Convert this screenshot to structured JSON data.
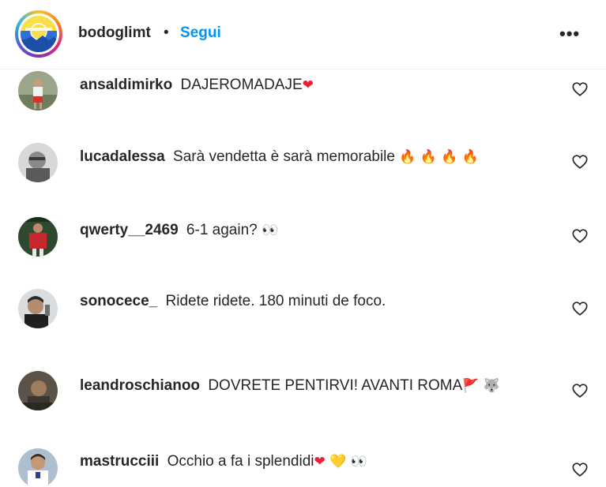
{
  "post": {
    "author": "bodoglimt",
    "separator": "•",
    "follow_label": "Segui",
    "more_label": "•••"
  },
  "comments": [
    {
      "user": "ansaldimirko",
      "text": "DAJEROMADAJE",
      "emoji": [
        "❤"
      ]
    },
    {
      "user": "lucadalessa",
      "text": "Sarà vendetta è sarà memorabile",
      "emoji": [
        "🔥",
        "🔥",
        "🔥",
        "🔥"
      ]
    },
    {
      "user": "qwerty__2469",
      "text": "6-1 again?",
      "emoji": [
        "👀"
      ]
    },
    {
      "user": "sonocece_",
      "text": "Ridete ridete. 180 minuti de foco.",
      "emoji": []
    },
    {
      "user": "leandroschianoo",
      "text": "DOVRETE PENTIRVI! AVANTI ROMA",
      "emoji": [
        "🚩",
        "🐺"
      ]
    },
    {
      "user": "mastrucciii",
      "text": "Occhio a fa i splendidi",
      "emoji": [
        "❤",
        "💛",
        "👀"
      ]
    }
  ],
  "icons": {
    "more": "more-options-icon",
    "like": "heart-outline-icon"
  },
  "colors": {
    "follow": "#0095f6",
    "text": "#262626",
    "heart_red": "#ed1e3a"
  }
}
